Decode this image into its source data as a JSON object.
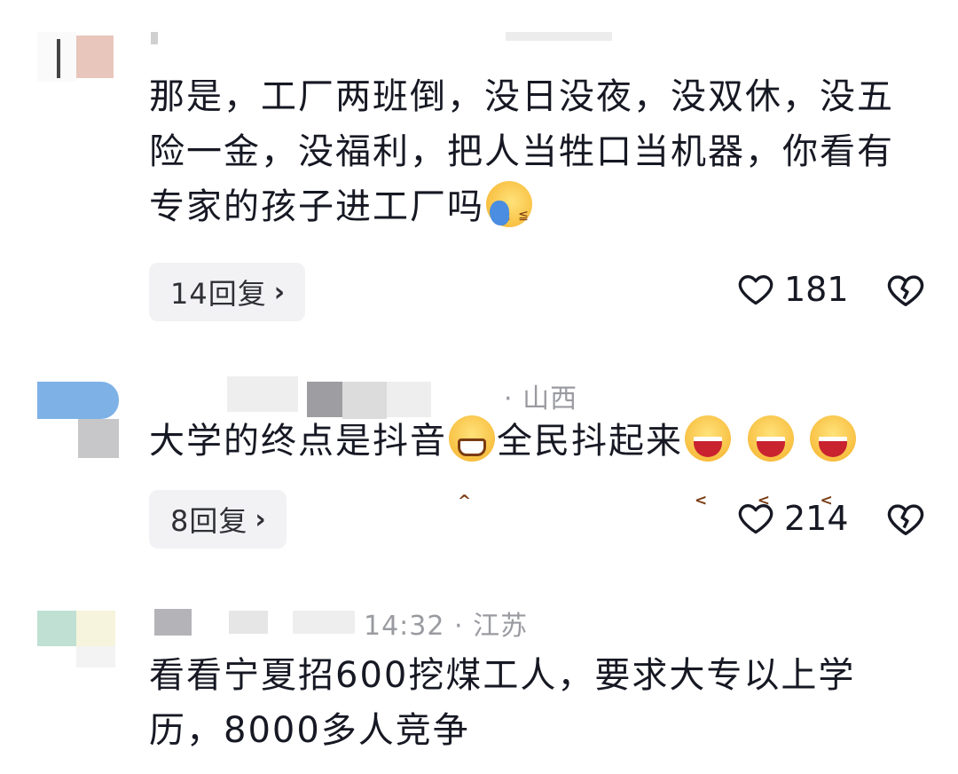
{
  "comments": [
    {
      "location": "",
      "text": "那是，工厂两班倒，没日没夜，没双休，没五险一金，没福利，把人当牲口当机器，你看有专家的孩子进工厂吗",
      "emoji": "cry-icon",
      "reply_label": "14回复",
      "likes": "181"
    },
    {
      "location": "· 山西",
      "text_a": "大学的终点是抖音",
      "text_b": "全民抖起来",
      "reply_label": "8回复",
      "likes": "214"
    },
    {
      "meta": "14:32 · 江苏",
      "text": "看看宁夏招600挖煤工人，要求大专以上学历，8000多人竞争"
    }
  ],
  "colors": {
    "text": "#161823",
    "meta": "#9a9ba1",
    "reply_bg": "#f2f2f4"
  }
}
